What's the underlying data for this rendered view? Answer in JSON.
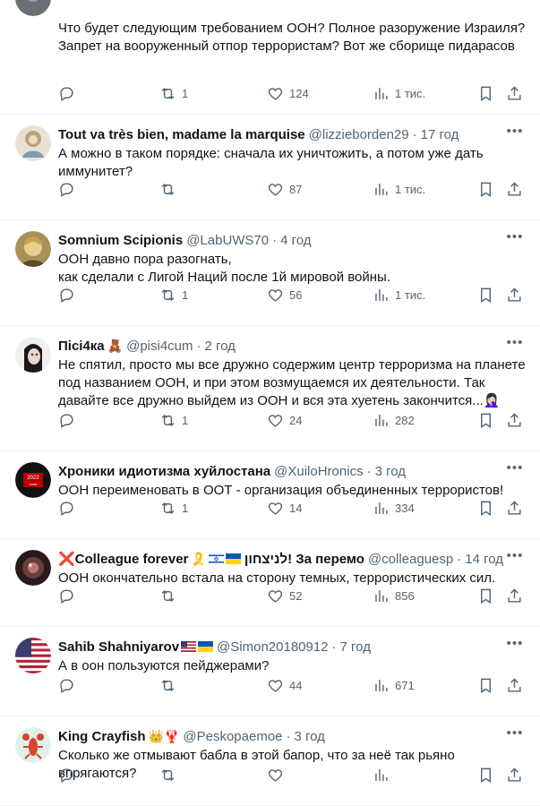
{
  "posts": [
    {
      "name": "",
      "handle": "",
      "time": "",
      "text": "Что будет следующим требованием ООН? Полное разоружение Израиля? Запрет на вооруженный отпор террористам? Вот же сборище пидарасов",
      "stats": {
        "replies": "",
        "retweets": "1",
        "likes": "124",
        "views": "1 тис."
      }
    },
    {
      "name": "Tout va très bien, madame la marquise",
      "handle": "@lizzieborden29",
      "time": "17 год",
      "text": "А можно в таком порядке: сначала их уничтожить, а потом уже дать иммунитет?",
      "stats": {
        "replies": "",
        "retweets": "",
        "likes": "87",
        "views": "1 тис."
      }
    },
    {
      "name": "Somnium Scipionis",
      "handle": "@LabUWS70",
      "time": "4 год",
      "text": "ООН давно пора разогнать,\nкак сделали с Лигой Наций после 1й мировой войны.",
      "stats": {
        "replies": "",
        "retweets": "1",
        "likes": "56",
        "views": "1 тис."
      }
    },
    {
      "name": "Пісі4ка",
      "name_emoji": "🧸",
      "handle": "@pisi4cum",
      "time": "2 год",
      "text": "Не спятил, просто мы все дружно содержим центр терроризма на планете под названием ООН, и при этом возмущаемся их деятельности. Так давайте все дружно выйдем из ООН и вся эта хуетень закончится...🤦🏻‍♀️",
      "stats": {
        "replies": "",
        "retweets": "1",
        "likes": "24",
        "views": "282"
      }
    },
    {
      "name": "Хроники идиотизма хуйлостана",
      "handle": "@XuiloHronics",
      "time": "3 год",
      "text": "ООН переименовать в ООТ - организация объединенных террористов!",
      "stats": {
        "replies": "",
        "retweets": "1",
        "likes": "14",
        "views": "334"
      }
    },
    {
      "name": "❌Colleague forever",
      "name_emoji": "🎗️",
      "name_suffix": "לניצחון! За перемо",
      "handle": "@colleaguesp",
      "time": "14 год",
      "text": "ООН окончательно встала на сторону темных, террористических сил.",
      "stats": {
        "replies": "",
        "retweets": "",
        "likes": "52",
        "views": "856"
      }
    },
    {
      "name": "Sahib Shahniyarov",
      "handle": "@Simon20180912",
      "time": "7 год",
      "text": "А в оон пользуются пейджерами?",
      "stats": {
        "replies": "",
        "retweets": "",
        "likes": "44",
        "views": "671"
      }
    },
    {
      "name": "King Crayfish",
      "name_emoji": "👑🦞",
      "handle": "@Peskopaemoe",
      "time": "3 год",
      "text": "Сколько же отмывают бабла в этой бапор, что за неё так рьяно впрягаются?",
      "stats": {
        "replies": "",
        "retweets": "",
        "likes": "",
        "views": ""
      }
    }
  ],
  "icons": {
    "reply": "reply-icon",
    "retweet": "retweet-icon",
    "like": "heart-icon",
    "views": "views-icon",
    "bookmark": "bookmark-icon",
    "share": "share-icon",
    "more": "more-icon"
  },
  "colors": {
    "text": "#0f1419",
    "muted": "#536471",
    "divider": "#eff3f4"
  }
}
